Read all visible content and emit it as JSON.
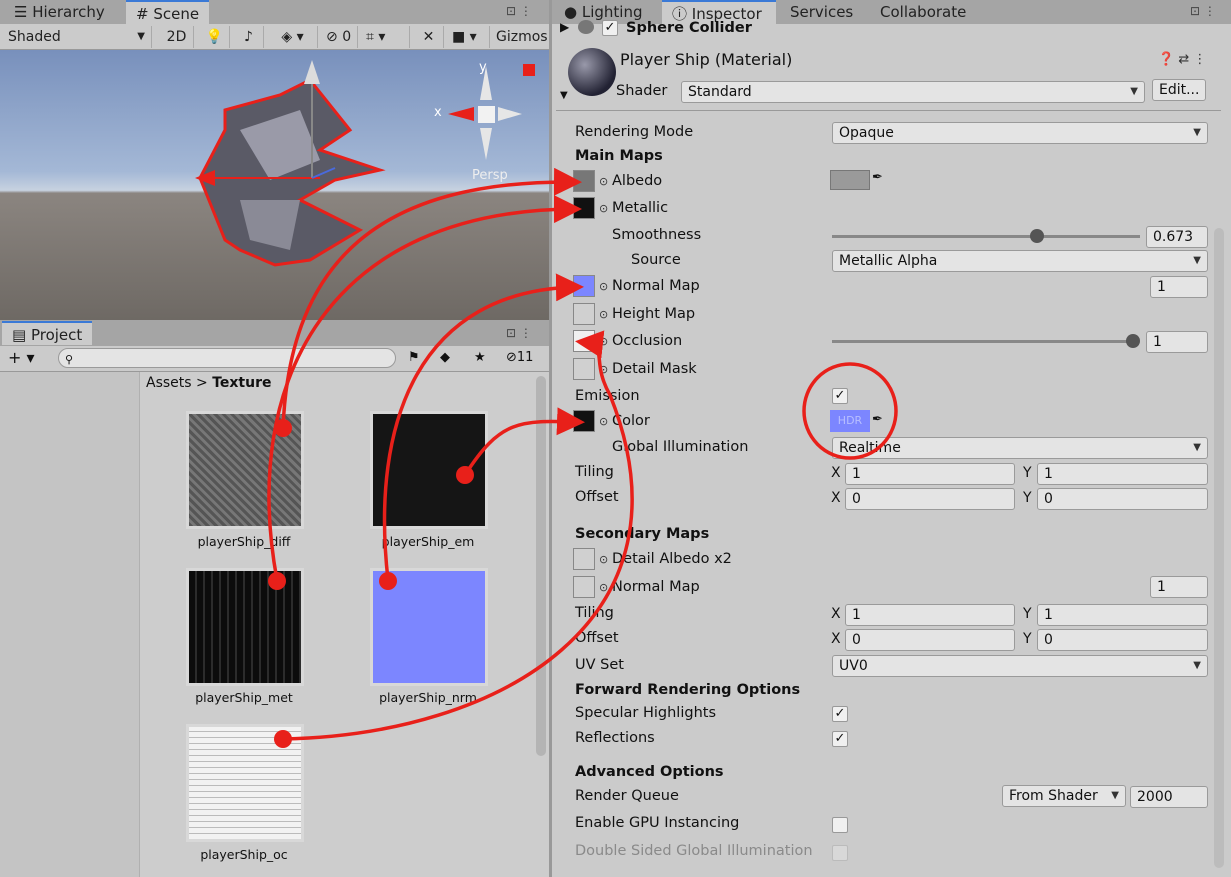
{
  "left_tabs": {
    "hierarchy": "Hierarchy",
    "scene": "Scene"
  },
  "scene_toolbar": {
    "shading_mode": "Shaded",
    "mode_2d": "2D",
    "hidden_count": "0",
    "gizmos": "Gizmos"
  },
  "scene_view": {
    "y_axis": "y",
    "x_axis": "x",
    "projection": "Persp"
  },
  "project": {
    "tab": "Project",
    "search_placeholder": "",
    "hidden_count": "11",
    "breadcrumb_root": "Assets",
    "breadcrumb_sep": ">",
    "breadcrumb_current": "Texture",
    "assets": [
      "playerShip_diff",
      "playerShip_em",
      "playerShip_met",
      "playerShip_nrm",
      "playerShip_oc"
    ]
  },
  "right_tabs": {
    "lighting": "Lighting",
    "inspector": "Inspector",
    "services": "Services",
    "collaborate": "Collaborate"
  },
  "inspector": {
    "component_header": "Sphere Collider",
    "material_name": "Player Ship (Material)",
    "shader_label": "Shader",
    "shader_value": "Standard",
    "edit_button": "Edit...",
    "rendering_mode_label": "Rendering Mode",
    "rendering_mode_value": "Opaque",
    "main_maps_header": "Main Maps",
    "albedo": "Albedo",
    "metallic": "Metallic",
    "smoothness_label": "Smoothness",
    "smoothness_value": "0.673",
    "source_label": "Source",
    "source_value": "Metallic Alpha",
    "normal_map": "Normal Map",
    "normal_map_value": "1",
    "height_map": "Height Map",
    "occlusion": "Occlusion",
    "occlusion_value": "1",
    "detail_mask": "Detail Mask",
    "emission_label": "Emission",
    "color_label": "Color",
    "hdr_label": "HDR",
    "global_illumination_label": "Global Illumination",
    "global_illumination_value": "Realtime",
    "tiling_label": "Tiling",
    "offset_label": "Offset",
    "axis_x": "X",
    "axis_y": "Y",
    "main_tiling_x": "1",
    "main_tiling_y": "1",
    "main_offset_x": "0",
    "main_offset_y": "0",
    "secondary_maps_header": "Secondary Maps",
    "detail_albedo": "Detail Albedo x2",
    "secondary_normal_map": "Normal Map",
    "secondary_normal_value": "1",
    "sec_tiling_x": "1",
    "sec_tiling_y": "1",
    "sec_offset_x": "0",
    "sec_offset_y": "0",
    "uv_set_label": "UV Set",
    "uv_set_value": "UV0",
    "forward_header": "Forward Rendering Options",
    "specular_highlights": "Specular Highlights",
    "reflections": "Reflections",
    "advanced_header": "Advanced Options",
    "render_queue_label": "Render Queue",
    "render_queue_mode": "From Shader",
    "render_queue_value": "2000",
    "gpu_instancing": "Enable GPU Instancing",
    "double_sided_gi": "Double Sided Global Illumination"
  },
  "colors": {
    "annotation_red": "#e8201a",
    "normal_map_blue": "#7c86ff",
    "tab_accent": "#3a79d6"
  }
}
